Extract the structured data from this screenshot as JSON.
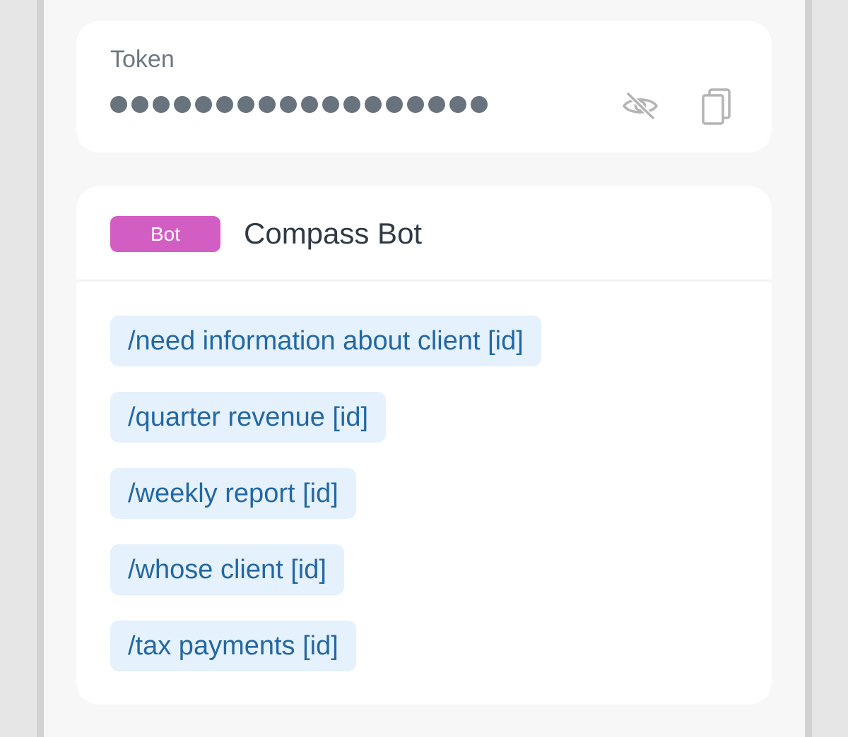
{
  "token": {
    "label": "Token",
    "masked_length": 18,
    "toggle_icon": "eye-off-icon",
    "copy_icon": "copy-icon"
  },
  "bot": {
    "badge": "Bot",
    "name": "Compass Bot",
    "commands": [
      "/need information about client [id]",
      "/quarter revenue [id]",
      "/weekly report [id]",
      "/whose client [id]",
      "/tax payments [id]"
    ]
  },
  "colors": {
    "badge_bg": "#d25ec4",
    "chip_bg": "#e5f1fc",
    "chip_text": "#2368a2",
    "dot": "#68737e"
  }
}
